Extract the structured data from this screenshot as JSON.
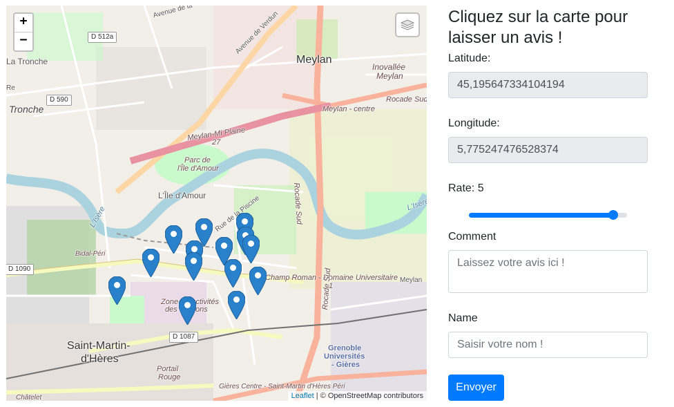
{
  "map": {
    "zoom_in": "+",
    "zoom_out": "−",
    "attribution_link": "Leaflet",
    "attribution_sep": " | © ",
    "attribution_text": "OpenStreetMap contributors",
    "labels": {
      "meylan": "Meylan",
      "la_tronche": "La Tronche",
      "tronche": "Tronche",
      "saint_martin_1": "Saint-Martin-",
      "saint_martin_2": "d'Hères",
      "inovallee_1": "Inovallée",
      "inovallee_2": "Meylan",
      "meylan_centre": "Meylan - centre",
      "rocade_sud_top": "Rocade Sud",
      "rocade_sud_v1": "Rocade Sud",
      "rocade_sud_v2": "Rocade Sud",
      "meylan_mi_plaine": "Meylan-Mi Plaine",
      "meylan_27": "27",
      "parc_1": "Parc de",
      "parc_2": "l'Île d'Amour",
      "ile_amour": "L'Île d'Amour",
      "rue_piscine": "Rue de la Piscine",
      "avenue_verdun": "Avenue de Verdun",
      "avenue_de_la": "Avenue de la",
      "champ_roman": "Champ Roman - Domaine Universitaire",
      "champ_roman_1": "1",
      "zone_1": "Zone de Activités",
      "zone_2": "des Glairons",
      "grenoble_1": "Grenoble",
      "grenoble_2": "Universités",
      "grenoble_3": "- Gières",
      "portail_1": "Portail",
      "portail_2": "Rouge",
      "gieres": "Gières Centre - Saint-Martin d'Hères Péri",
      "bidal": "Bidal-Péri",
      "meylan_right": "Meylan",
      "isere_left": "L'Isère",
      "isere_right": "L'Isère",
      "chatelet": "Châtelet",
      "re": "Re"
    },
    "badges": {
      "d512a": "D 512a",
      "d590": "D 590",
      "d1090": "D 1090",
      "d1087": "D 1087"
    },
    "icons": {
      "layers": "layers-icon",
      "marker": "map-marker-icon"
    }
  },
  "form": {
    "title": "Cliquez sur la carte pour laisser un avis !",
    "latitude_label": "Latitude:",
    "latitude_value": "45,195647334104194",
    "longitude_label": "Longitude:",
    "longitude_value": "5,775247476528374",
    "rate_label": "Rate: 5",
    "rate_value": 5,
    "rate_max": 5,
    "comment_label": "Comment",
    "comment_placeholder": "Laissez votre avis ici !",
    "name_label": "Name",
    "name_placeholder": "Saisir votre nom !",
    "submit_label": "Envoyer"
  },
  "colors": {
    "accent": "#007bff",
    "marker": "#2a81cb",
    "river": "#aad3df",
    "highway": "#e892a2",
    "trunk": "#f9b29c",
    "park": "#c8facc"
  }
}
